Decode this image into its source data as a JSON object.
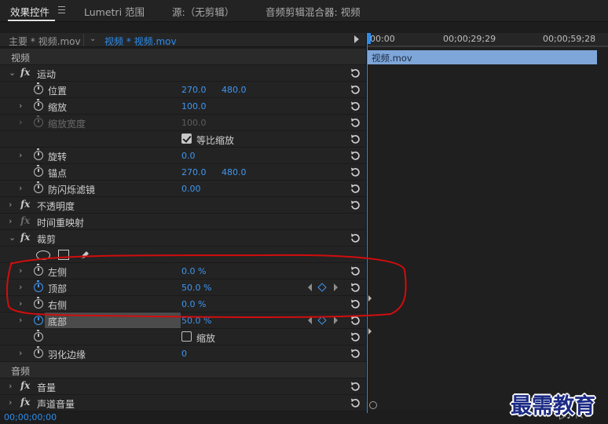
{
  "tabs": [
    {
      "label": "效果控件",
      "active": true
    },
    {
      "label": "Lumetri 范围",
      "active": false
    },
    {
      "label": "源:（无剪辑）",
      "active": false
    },
    {
      "label": "音频剪辑混合器: 视频",
      "active": false
    }
  ],
  "source": {
    "master": "主要 * 视频.mov",
    "sequence": "视频 * 视频.mov"
  },
  "sections": {
    "video": "视频",
    "audio": "音频"
  },
  "motion": {
    "label": "运动",
    "position": {
      "label": "位置",
      "x": "270.0",
      "y": "480.0"
    },
    "scale": {
      "label": "缩放",
      "value": "100.0"
    },
    "scale_width": {
      "label": "缩放宽度",
      "value": "100.0"
    },
    "uniform_scale": "等比缩放",
    "rotation": {
      "label": "旋转",
      "value": "0.0"
    },
    "anchor": {
      "label": "锚点",
      "x": "270.0",
      "y": "480.0"
    },
    "anti_flicker": {
      "label": "防闪烁滤镜",
      "value": "0.00"
    }
  },
  "opacity": {
    "label": "不透明度"
  },
  "time_remap": {
    "label": "时间重映射"
  },
  "crop": {
    "label": "裁剪",
    "left": {
      "label": "左侧",
      "value": "0.0",
      "unit": "%"
    },
    "top": {
      "label": "顶部",
      "value": "50.0",
      "unit": "%"
    },
    "right": {
      "label": "右侧",
      "value": "0.0",
      "unit": "%"
    },
    "bottom": {
      "label": "底部",
      "value": "50.0",
      "unit": "%"
    },
    "zoom": "缩放",
    "feather": {
      "label": "羽化边缘",
      "value": "0"
    }
  },
  "audio": {
    "volume": "音量",
    "channel_volume": "声道音量"
  },
  "timeline": {
    "ticks": [
      "00:00",
      "00;00;29;29",
      "00;00;59;28"
    ],
    "clip": "视频.mov"
  },
  "timecode": "00;00;00;00",
  "watermark": "最需教育",
  "colors": {
    "accent": "#2d8ceb",
    "annotation": "#d10d0d",
    "clip": "#7ea6d8"
  }
}
